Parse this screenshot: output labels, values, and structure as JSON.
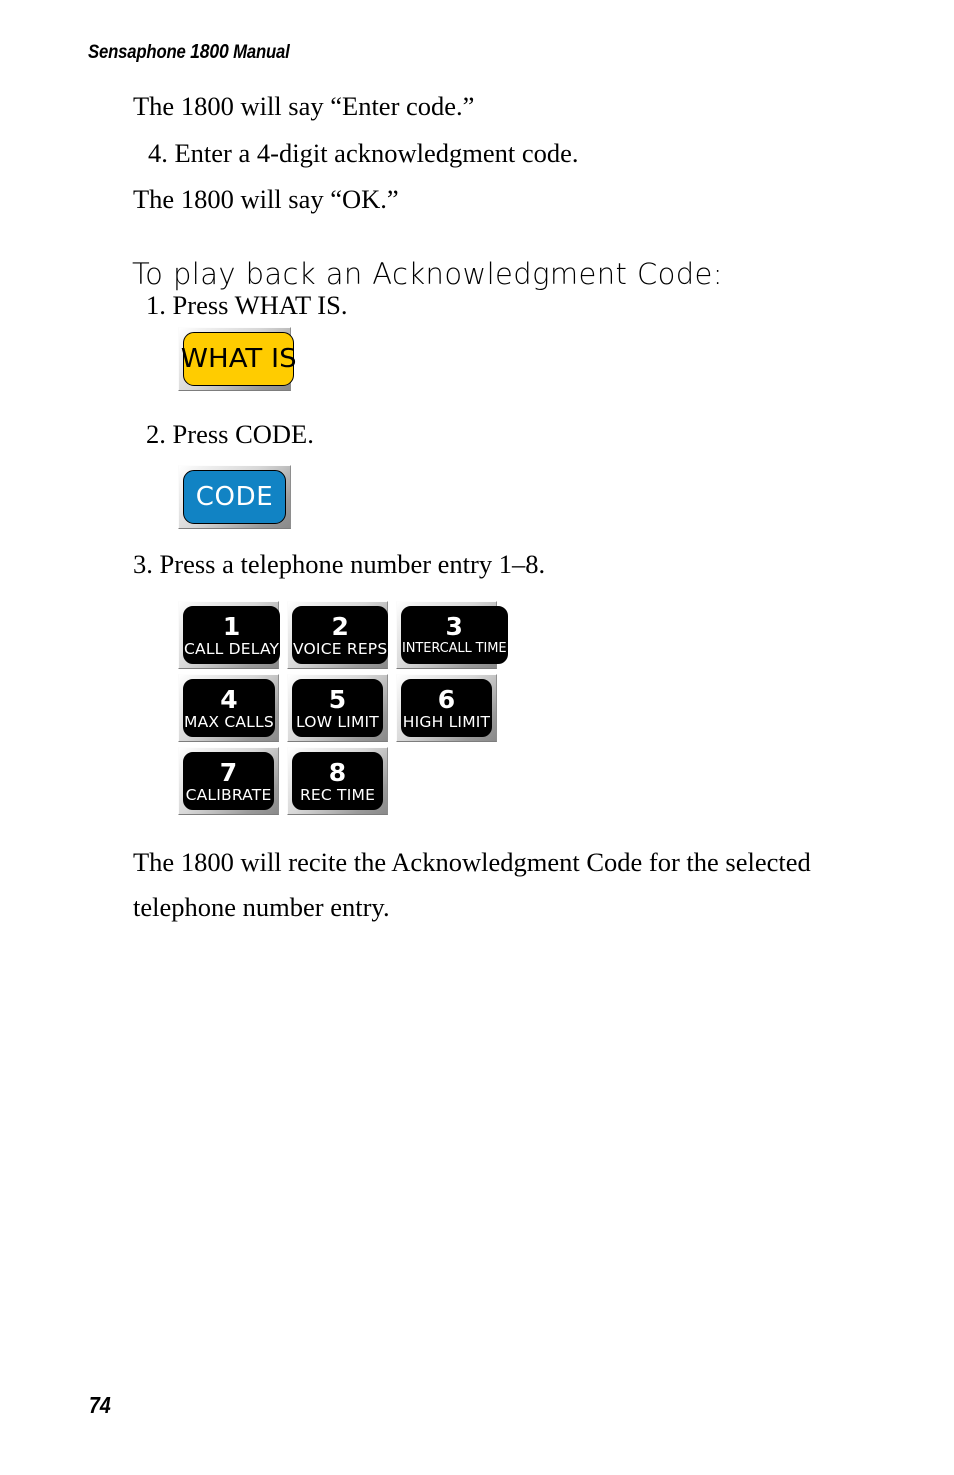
{
  "header": {
    "prefix": "Sensaphone ",
    "model": "1800",
    "suffix": " Manual"
  },
  "body": {
    "enter_code_line": "The 1800 will say “Enter code.”",
    "step4": "4. Enter a 4-digit acknowledgment code.",
    "ok_line": "The 1800 will say “OK.”",
    "section_heading": "To play back an Acknowledgment Code:",
    "step1": "1. Press WHAT IS.",
    "step2": "2. Press CODE.",
    "step3": "3. Press a telephone number entry 1–8.",
    "closing": "The 1800 will recite the Acknowledgment Code for the selected telephone number entry."
  },
  "keys": {
    "what_is": {
      "label": "WHAT IS",
      "face_color": "#ffcc00",
      "text_color": "#000000"
    },
    "code": {
      "label": "CODE",
      "face_color": "#1183c4",
      "text_color": "#ffffff"
    }
  },
  "keypad": {
    "face_color": "#000000",
    "text_color": "#ffffff",
    "buttons": [
      {
        "digit": "1",
        "function": "CALL DELAY",
        "small": false
      },
      {
        "digit": "2",
        "function": "VOICE REPS",
        "small": false
      },
      {
        "digit": "3",
        "function": "INTERCALL TIME",
        "small": true
      },
      {
        "digit": "4",
        "function": "MAX CALLS",
        "small": false
      },
      {
        "digit": "5",
        "function": "LOW LIMIT",
        "small": false
      },
      {
        "digit": "6",
        "function": "HIGH LIMIT",
        "small": false
      },
      {
        "digit": "7",
        "function": "CALIBRATE",
        "small": false
      },
      {
        "digit": "8",
        "function": "REC TIME",
        "small": false
      }
    ]
  },
  "footer": {
    "page_number": "74"
  }
}
